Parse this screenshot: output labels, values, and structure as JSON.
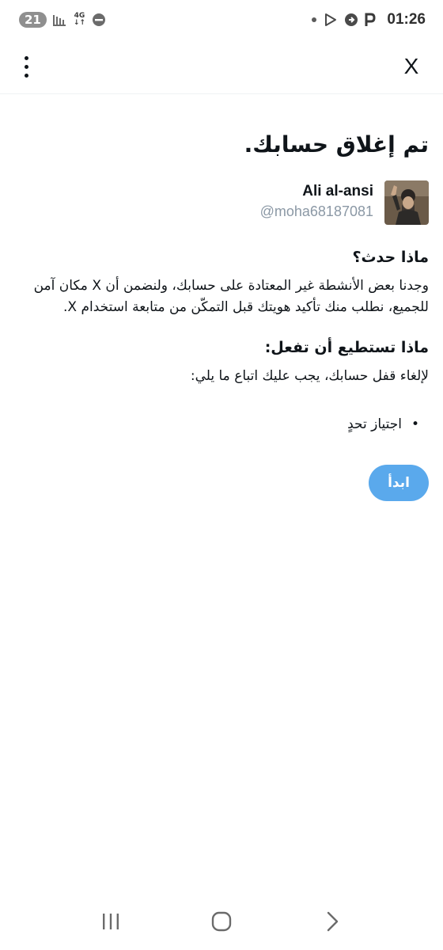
{
  "status_bar": {
    "notification_count": "21",
    "network_type": "4G",
    "network_arrows": "↓↑",
    "time": "01:26",
    "icons_left": [
      "signal-bars-icon",
      "network-4g-icon",
      "do-not-disturb-icon"
    ],
    "icons_right": [
      "dot-icon",
      "play-store-icon",
      "app-icon",
      "parking-icon"
    ]
  },
  "app_bar": {
    "menu_icon": "more-vertical-icon",
    "close_label": "X"
  },
  "main": {
    "title": "تم إغلاق حسابك.",
    "account": {
      "display_name": "Ali al-ansi",
      "handle": "@moha68187081"
    },
    "what_happened": {
      "heading": "ماذا حدث؟",
      "body": "وجدنا بعض الأنشطة غير المعتادة على حسابك، ولنضمن أن X مكان آمن للجميع، نطلب منك تأكيد هويتك قبل التمكّن من متابعة استخدام X."
    },
    "what_you_can_do": {
      "heading": "ماذا تستطيع أن تفعل:",
      "body": "لإلغاء قفل حسابك، يجب عليك اتباع ما يلي:",
      "steps": [
        "اجتياز تحدٍ"
      ]
    },
    "start_button": "ابدأ"
  },
  "nav_bar": {
    "buttons": [
      "recent-apps-icon",
      "home-icon",
      "back-icon"
    ]
  },
  "colors": {
    "accent": "#5aa9ec",
    "text": "#0f1419",
    "secondary_text": "#8b98a5"
  }
}
